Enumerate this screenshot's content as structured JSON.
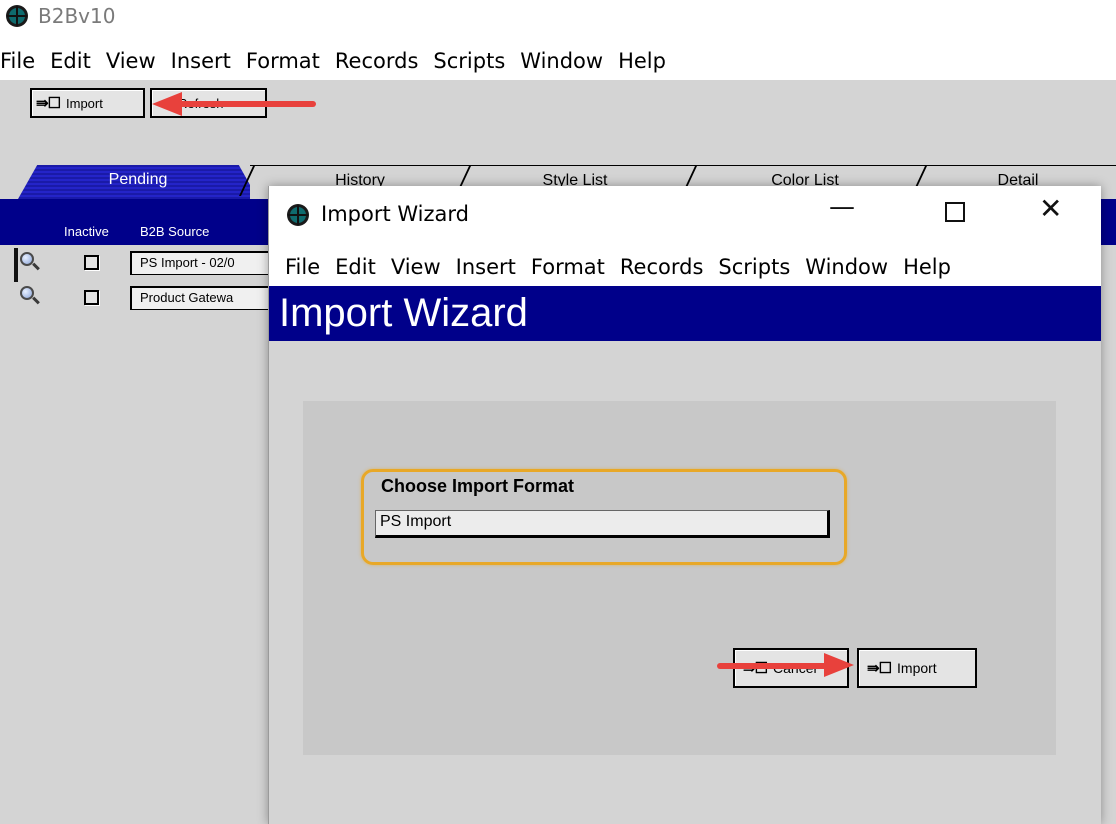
{
  "background_app": {
    "title": "B2Bv10",
    "menu": [
      "File",
      "Edit",
      "View",
      "Insert",
      "Format",
      "Records",
      "Scripts",
      "Window",
      "Help"
    ],
    "toolbar": {
      "import_glyph": "⇛☐",
      "import_label": "Import",
      "refresh_label": "Refresh"
    },
    "tabs": [
      {
        "label": "Pending",
        "active": true
      },
      {
        "label": "History",
        "active": false
      },
      {
        "label": "Style List",
        "active": false
      },
      {
        "label": "Color List",
        "active": false
      },
      {
        "label": "Detail",
        "active": false
      }
    ],
    "columns": [
      "Inactive",
      "B2B Source"
    ],
    "rows": [
      {
        "source": "PS Import - 02/0"
      },
      {
        "source": "Product Gatewa"
      }
    ]
  },
  "import_wizard": {
    "window_title": "Import Wizard",
    "menu": [
      "File",
      "Edit",
      "View",
      "Insert",
      "Format",
      "Records",
      "Scripts",
      "Window",
      "Help"
    ],
    "banner_title": "Import Wizard",
    "format_label": "Choose Import Format",
    "format_value": "PS Import",
    "cancel_label": "Cancel",
    "import_label": "Import",
    "import_glyph": "⇛☐"
  },
  "colors": {
    "header_navy": "#00008a",
    "panel_gray": "#d4d4d4",
    "highlight_orange": "#e8a828",
    "annotation_red": "#e8413c"
  }
}
